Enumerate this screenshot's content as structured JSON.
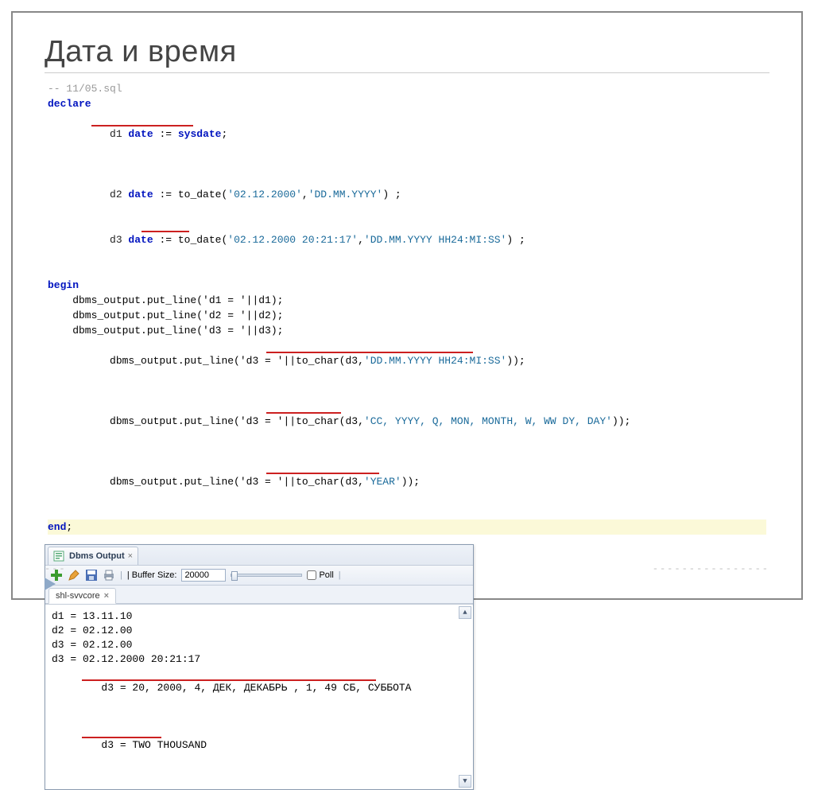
{
  "title": "Дата и время",
  "code": {
    "l1": "-- 11/05.sql",
    "l2_kw": "declare",
    "l3_a": "    d1 ",
    "l3_b": "date",
    "l3_c": " := ",
    "l3_d": "sysdate",
    "l3_e": ";",
    "l4_a": "    d2 ",
    "l4_b": "date",
    "l4_c": " := to_date(",
    "l4_d": "'02.12.2000'",
    "l4_e": ",",
    "l4_f": "'DD.MM.YYYY'",
    "l4_g": ") ;",
    "l5_a": "    d3 ",
    "l5_b": "date",
    "l5_c": " := ",
    "l5_d": "to_date",
    "l5_e": "(",
    "l5_f": "'02.12.2000 20:21:17'",
    "l5_g": ",",
    "l5_h": "'DD.MM.YYYY HH24:MI:SS'",
    "l5_i": ") ;",
    "l6_kw": "begin",
    "l7": "    dbms_output.put_line('d1 = '||d1);",
    "l8": "    dbms_output.put_line('d2 = '||d2);",
    "l9": "    dbms_output.put_line('d3 = '||d3);",
    "l10_a": "    dbms_output.put_line('d3 = '||",
    "l10_b": "to_char(d3,",
    "l10_c": "'DD.MM.YYYY HH24:MI:SS'",
    "l10_d": "));",
    "l11_a": "    dbms_output.put_line('d3 = '||",
    "l11_b": "to_char(d3,",
    "l11_c": "'CC, YYYY, Q, MON, MONTH, W, WW DY, DAY'",
    "l11_d": "));",
    "l12_a": "    dbms_output.put_line('d3 = '||",
    "l12_b": "to_char(d3,",
    "l12_c": "'YEAR'",
    "l12_d": "));",
    "l13_kw": "end",
    "l13_b": ";"
  },
  "panel": {
    "title": "Dbms Output",
    "buffer_label": "| Buffer Size:",
    "buffer_value": "20000",
    "poll_label": "Poll",
    "sep": "|",
    "subtab": "shl-svvcore"
  },
  "output": {
    "o1": "d1 = 13.11.10",
    "o2": "d2 = 02.12.00",
    "o3": "d3 = 02.12.00",
    "o4": "d3 = 02.12.2000 20:21:17",
    "o5": "d3 = 20, 2000, 4, ДЕК, ДЕКАБРЬ , 1, 49 СБ, СУББОТА",
    "o6": "d3 = TWO THOUSAND"
  },
  "dashes": {
    "left": "---",
    "right": "----------------"
  }
}
